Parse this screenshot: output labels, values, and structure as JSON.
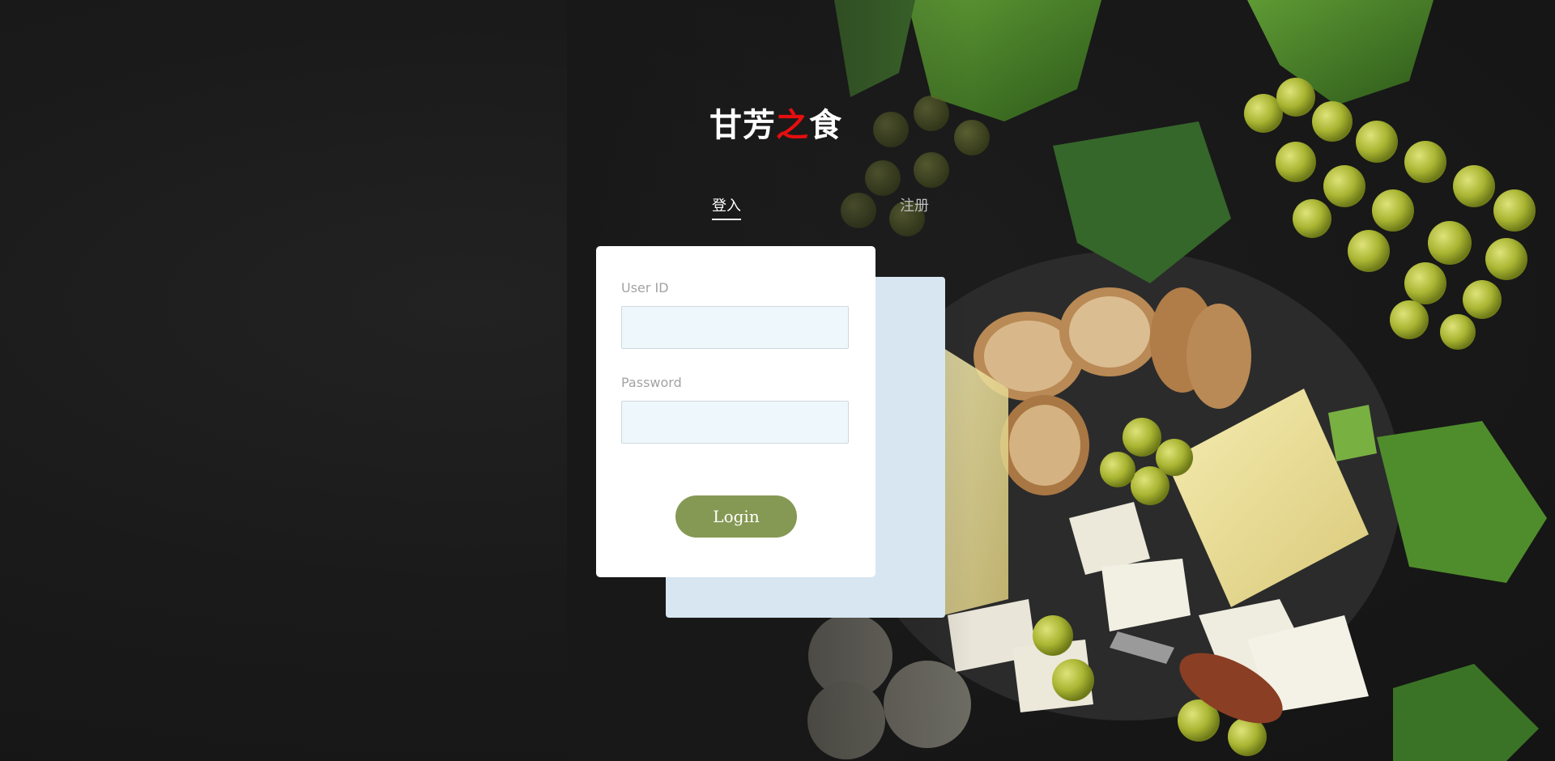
{
  "brand": {
    "part1": "甘芳",
    "accent": "之",
    "part2": "食",
    "accent_color": "#e50e0e"
  },
  "tabs": [
    {
      "label": "登入",
      "active": true
    },
    {
      "label": "注册",
      "active": false
    }
  ],
  "form": {
    "user_id_label": "User ID",
    "user_id_value": "",
    "password_label": "Password",
    "password_value": "",
    "submit_label": "Login"
  },
  "colors": {
    "button": "#869954",
    "card": "#ffffff",
    "back_card": "#d7e6f1",
    "input_bg": "#eef8fc"
  }
}
